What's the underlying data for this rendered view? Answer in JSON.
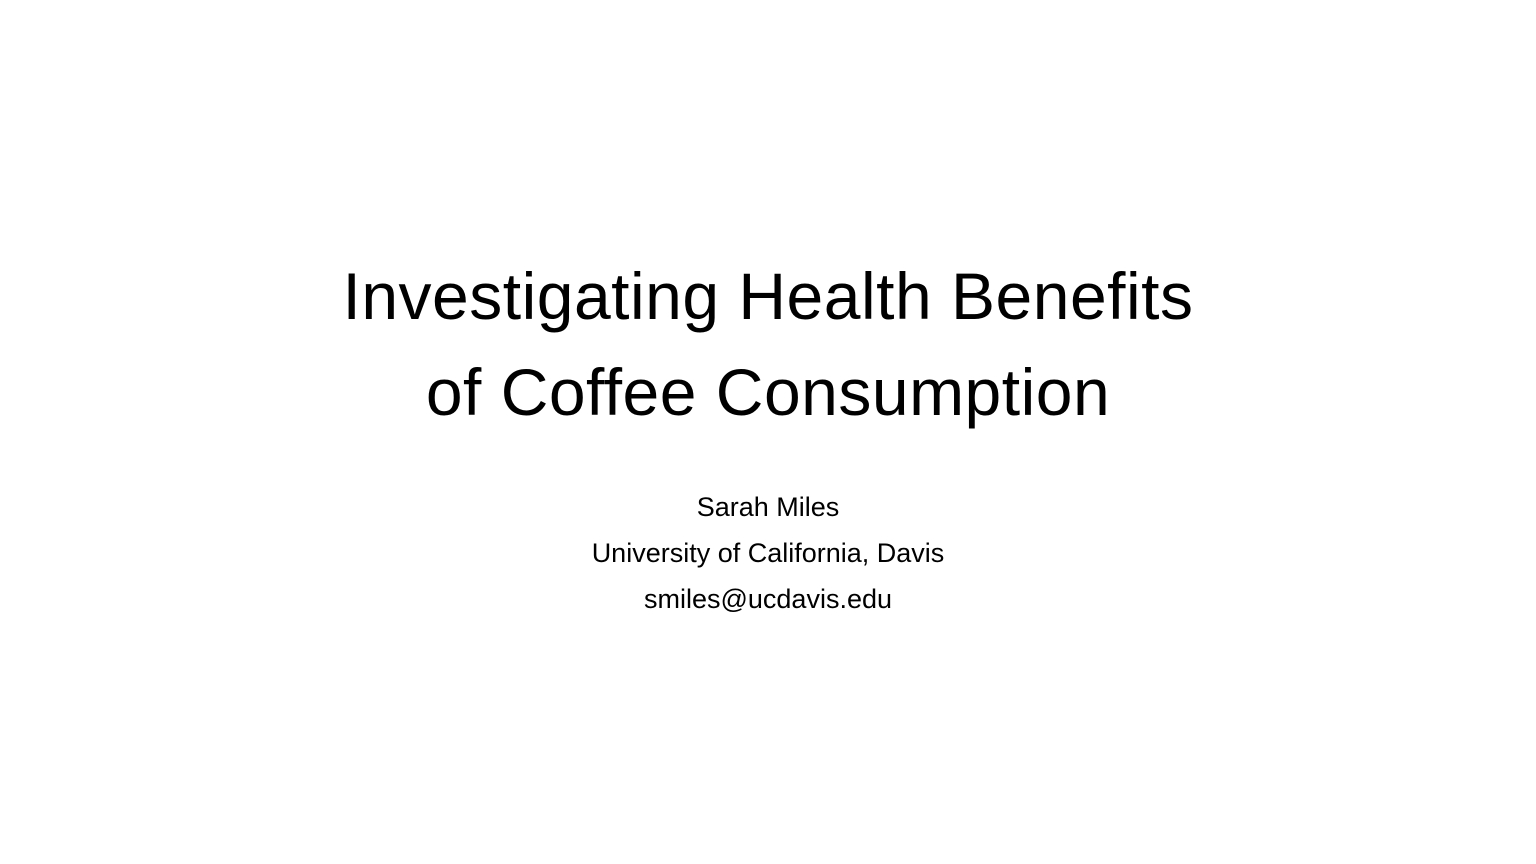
{
  "slide": {
    "title_lines": [
      "Investigating Health Benefits",
      "of Coffee Consumption"
    ],
    "author": "Sarah Miles",
    "affiliation": "University of California, Davis",
    "email": "smiles@ucdavis.edu"
  }
}
